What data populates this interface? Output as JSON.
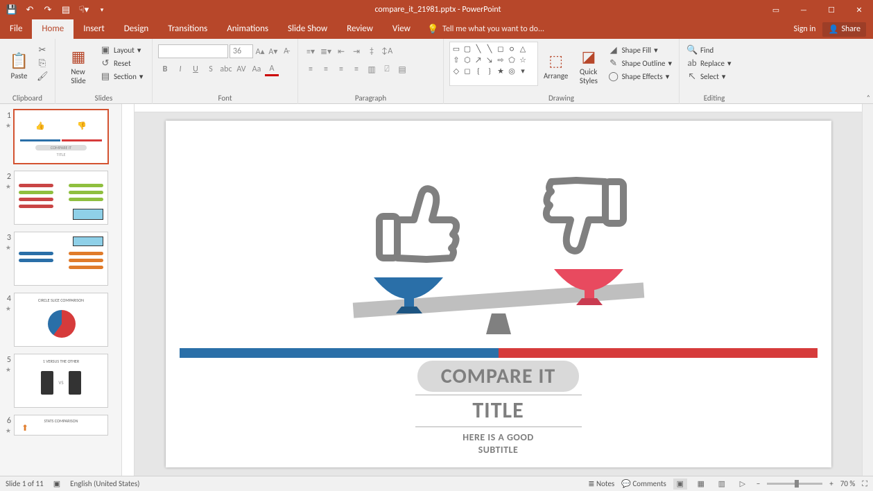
{
  "app": {
    "title": "compare_it_21981.pptx - PowerPoint"
  },
  "menu": {
    "file": "File",
    "home": "Home",
    "insert": "Insert",
    "design": "Design",
    "transitions": "Transitions",
    "animations": "Animations",
    "slideshow": "Slide Show",
    "review": "Review",
    "view": "View",
    "tellme": "Tell me what you want to do...",
    "signin": "Sign in",
    "share": "Share"
  },
  "ribbon": {
    "clipboard": {
      "label": "Clipboard",
      "paste": "Paste"
    },
    "slides": {
      "label": "Slides",
      "newslide": "New\nSlide",
      "layout": "Layout",
      "reset": "Reset",
      "section": "Section"
    },
    "font": {
      "label": "Font",
      "size": "36"
    },
    "paragraph": {
      "label": "Paragraph"
    },
    "drawing": {
      "label": "Drawing",
      "arrange": "Arrange",
      "quick": "Quick\nStyles",
      "shapefill": "Shape Fill",
      "shapeoutline": "Shape Outline",
      "shapeeffects": "Shape Effects"
    },
    "editing": {
      "label": "Editing",
      "find": "Find",
      "replace": "Replace",
      "select": "Select"
    }
  },
  "slide": {
    "compare": "COMPARE IT",
    "title": "TITLE",
    "sub1": "HERE IS A GOOD",
    "sub2": "SUBTITLE"
  },
  "status": {
    "page": "Slide 1 of 11",
    "lang": "English (United States)",
    "notes": "Notes",
    "comments": "Comments",
    "zoom": "70 %"
  },
  "thumbs": [
    1,
    2,
    3,
    4,
    5,
    6
  ]
}
